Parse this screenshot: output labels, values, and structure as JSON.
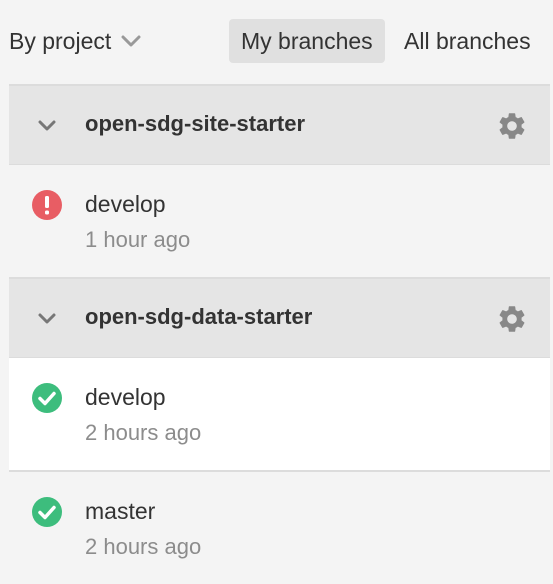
{
  "header": {
    "group_by_label": "By project",
    "filters": [
      {
        "label": "My branches",
        "active": true
      },
      {
        "label": "All branches",
        "active": false
      }
    ]
  },
  "projects": [
    {
      "name": "open-sdg-site-starter",
      "branches": [
        {
          "name": "develop",
          "time": "1 hour ago",
          "status": "failed"
        }
      ]
    },
    {
      "name": "open-sdg-data-starter",
      "branches": [
        {
          "name": "develop",
          "time": "2 hours ago",
          "status": "success"
        },
        {
          "name": "master",
          "time": "2 hours ago",
          "status": "success"
        }
      ]
    }
  ],
  "colors": {
    "failed": "#e85d64",
    "success": "#3dbd7d",
    "icon_gray": "#888888"
  }
}
